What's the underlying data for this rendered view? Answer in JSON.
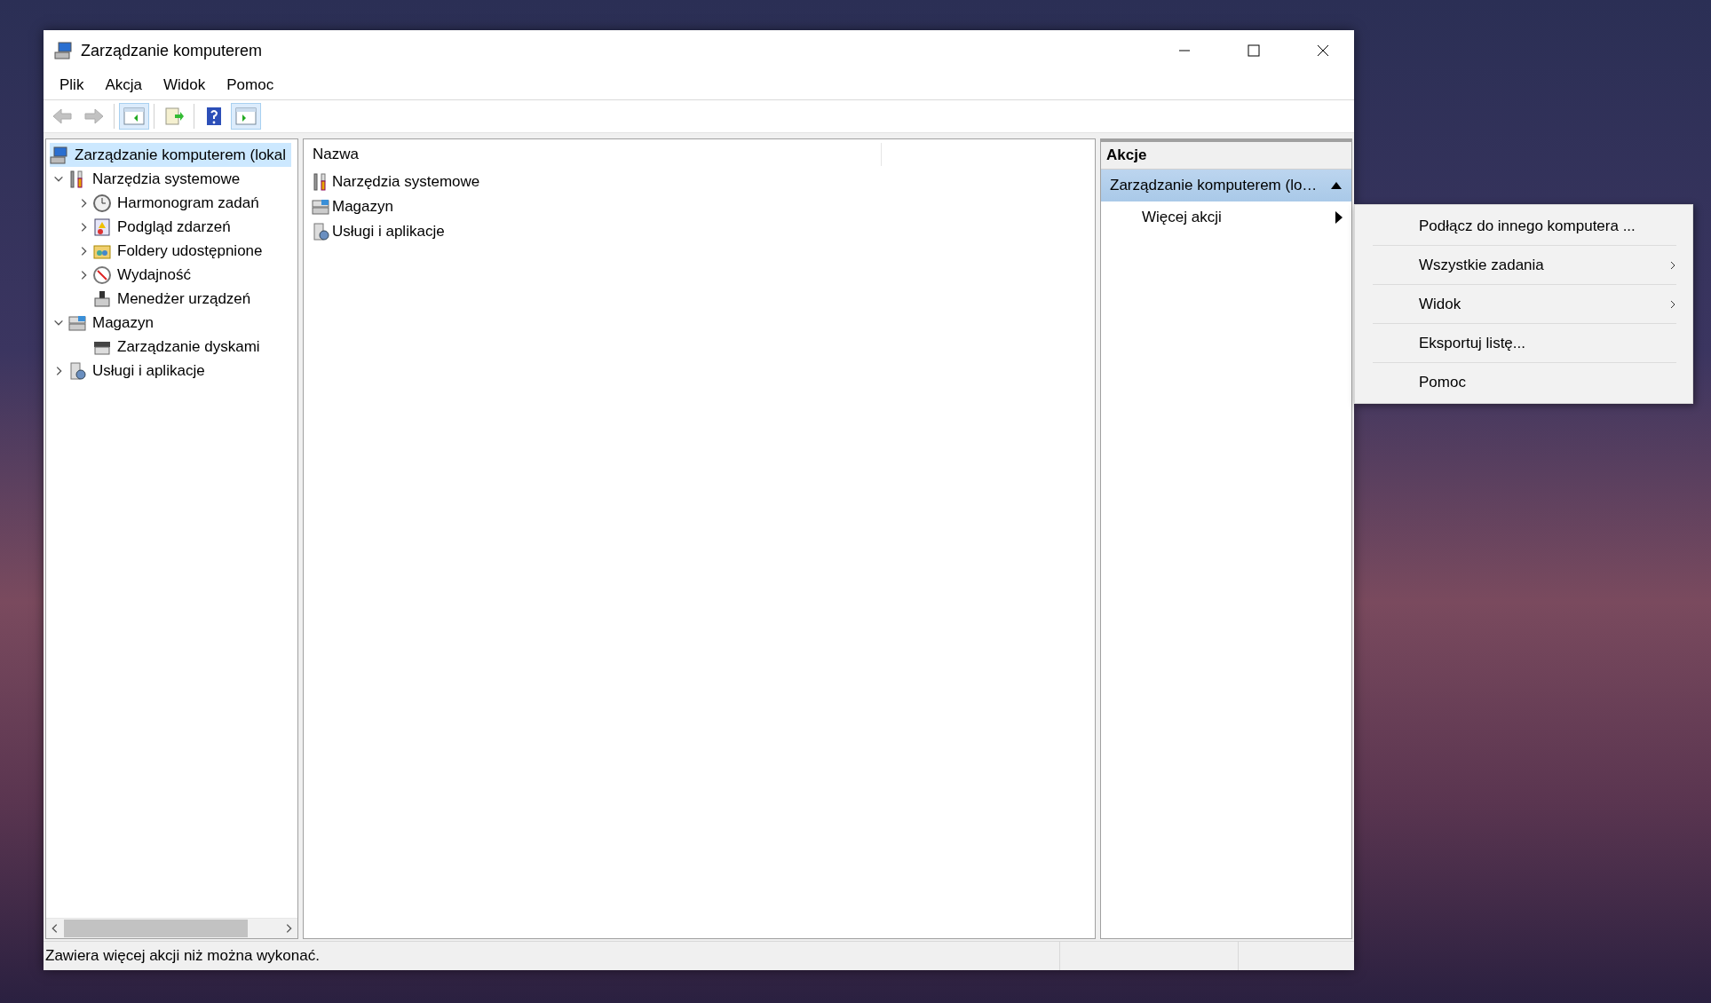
{
  "window": {
    "title": "Zarządzanie komputerem"
  },
  "menu": [
    "Plik",
    "Akcja",
    "Widok",
    "Pomoc"
  ],
  "toolbar": [
    {
      "kind": "back",
      "disabled": true,
      "pressed": false
    },
    {
      "kind": "forward",
      "disabled": true,
      "pressed": false
    },
    {
      "kind": "sep"
    },
    {
      "kind": "tree",
      "disabled": false,
      "pressed": true
    },
    {
      "kind": "sep"
    },
    {
      "kind": "export",
      "disabled": false,
      "pressed": false
    },
    {
      "kind": "sep"
    },
    {
      "kind": "help",
      "disabled": false,
      "pressed": false
    },
    {
      "kind": "actionpane",
      "disabled": false,
      "pressed": true
    }
  ],
  "tree": [
    {
      "label": "Zarządzanie komputerem (lokal",
      "kind": "computer",
      "selected": true,
      "children": [
        {
          "label": "Narzędzia systemowe",
          "kind": "tools",
          "selected": false,
          "expanded": true,
          "children": [
            {
              "label": "Harmonogram zadań",
              "kind": "clock",
              "selected": false,
              "expanded": false
            },
            {
              "label": "Podgląd zdarzeń",
              "kind": "event",
              "selected": false,
              "expanded": false
            },
            {
              "label": "Foldery udostępnione",
              "kind": "shared",
              "selected": false,
              "expanded": false
            },
            {
              "label": "Wydajność",
              "kind": "perf",
              "selected": false,
              "expanded": false
            },
            {
              "label": "Menedżer urządzeń",
              "kind": "device",
              "selected": false
            }
          ]
        },
        {
          "label": "Magazyn",
          "kind": "storage",
          "selected": false,
          "expanded": true,
          "children": [
            {
              "label": "Zarządzanie dyskami",
              "kind": "disk",
              "selected": false
            }
          ]
        },
        {
          "label": "Usługi i aplikacje",
          "kind": "services",
          "selected": false,
          "expanded": false
        }
      ]
    }
  ],
  "list": {
    "columns": [
      "Nazwa"
    ],
    "rows": [
      {
        "label": "Narzędzia systemowe",
        "kind": "tools"
      },
      {
        "label": "Magazyn",
        "kind": "storage"
      },
      {
        "label": "Usługi i aplikacje",
        "kind": "services"
      }
    ]
  },
  "actions": {
    "title": "Akcje",
    "section": {
      "label": "Zarządzanie komputerem (lo…",
      "selected": true,
      "expanded": true
    },
    "items": [
      {
        "label": "Więcej akcji",
        "submenu": true
      }
    ]
  },
  "context_menu": [
    {
      "label": "Podłącz do innego komputera ...",
      "submenu": false
    },
    {
      "label": "Wszystkie zadania",
      "submenu": true
    },
    {
      "label": "Widok",
      "submenu": true
    },
    {
      "label": "Eksportuj listę...",
      "submenu": false
    },
    {
      "label": "Pomoc",
      "submenu": false
    }
  ],
  "status_bar": {
    "text": "Zawiera więcej akcji niż można wykonać."
  }
}
